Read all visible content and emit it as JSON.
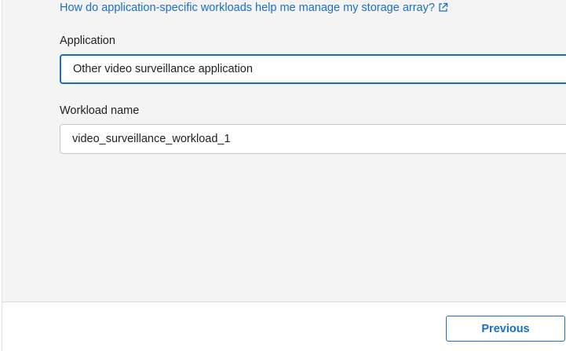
{
  "help": {
    "link_text": "How do application-specific workloads help me manage my storage array?",
    "icon": "external-link-icon"
  },
  "application": {
    "label": "Application",
    "selected_value": "Other video surveillance application"
  },
  "workload": {
    "label": "Workload name",
    "value": "video_surveillance_workload_1"
  },
  "footer": {
    "previous_label": "Previous"
  },
  "colors": {
    "accent": "#1a6fc2",
    "panel_background": "#f4f4f4",
    "text": "#222222"
  }
}
